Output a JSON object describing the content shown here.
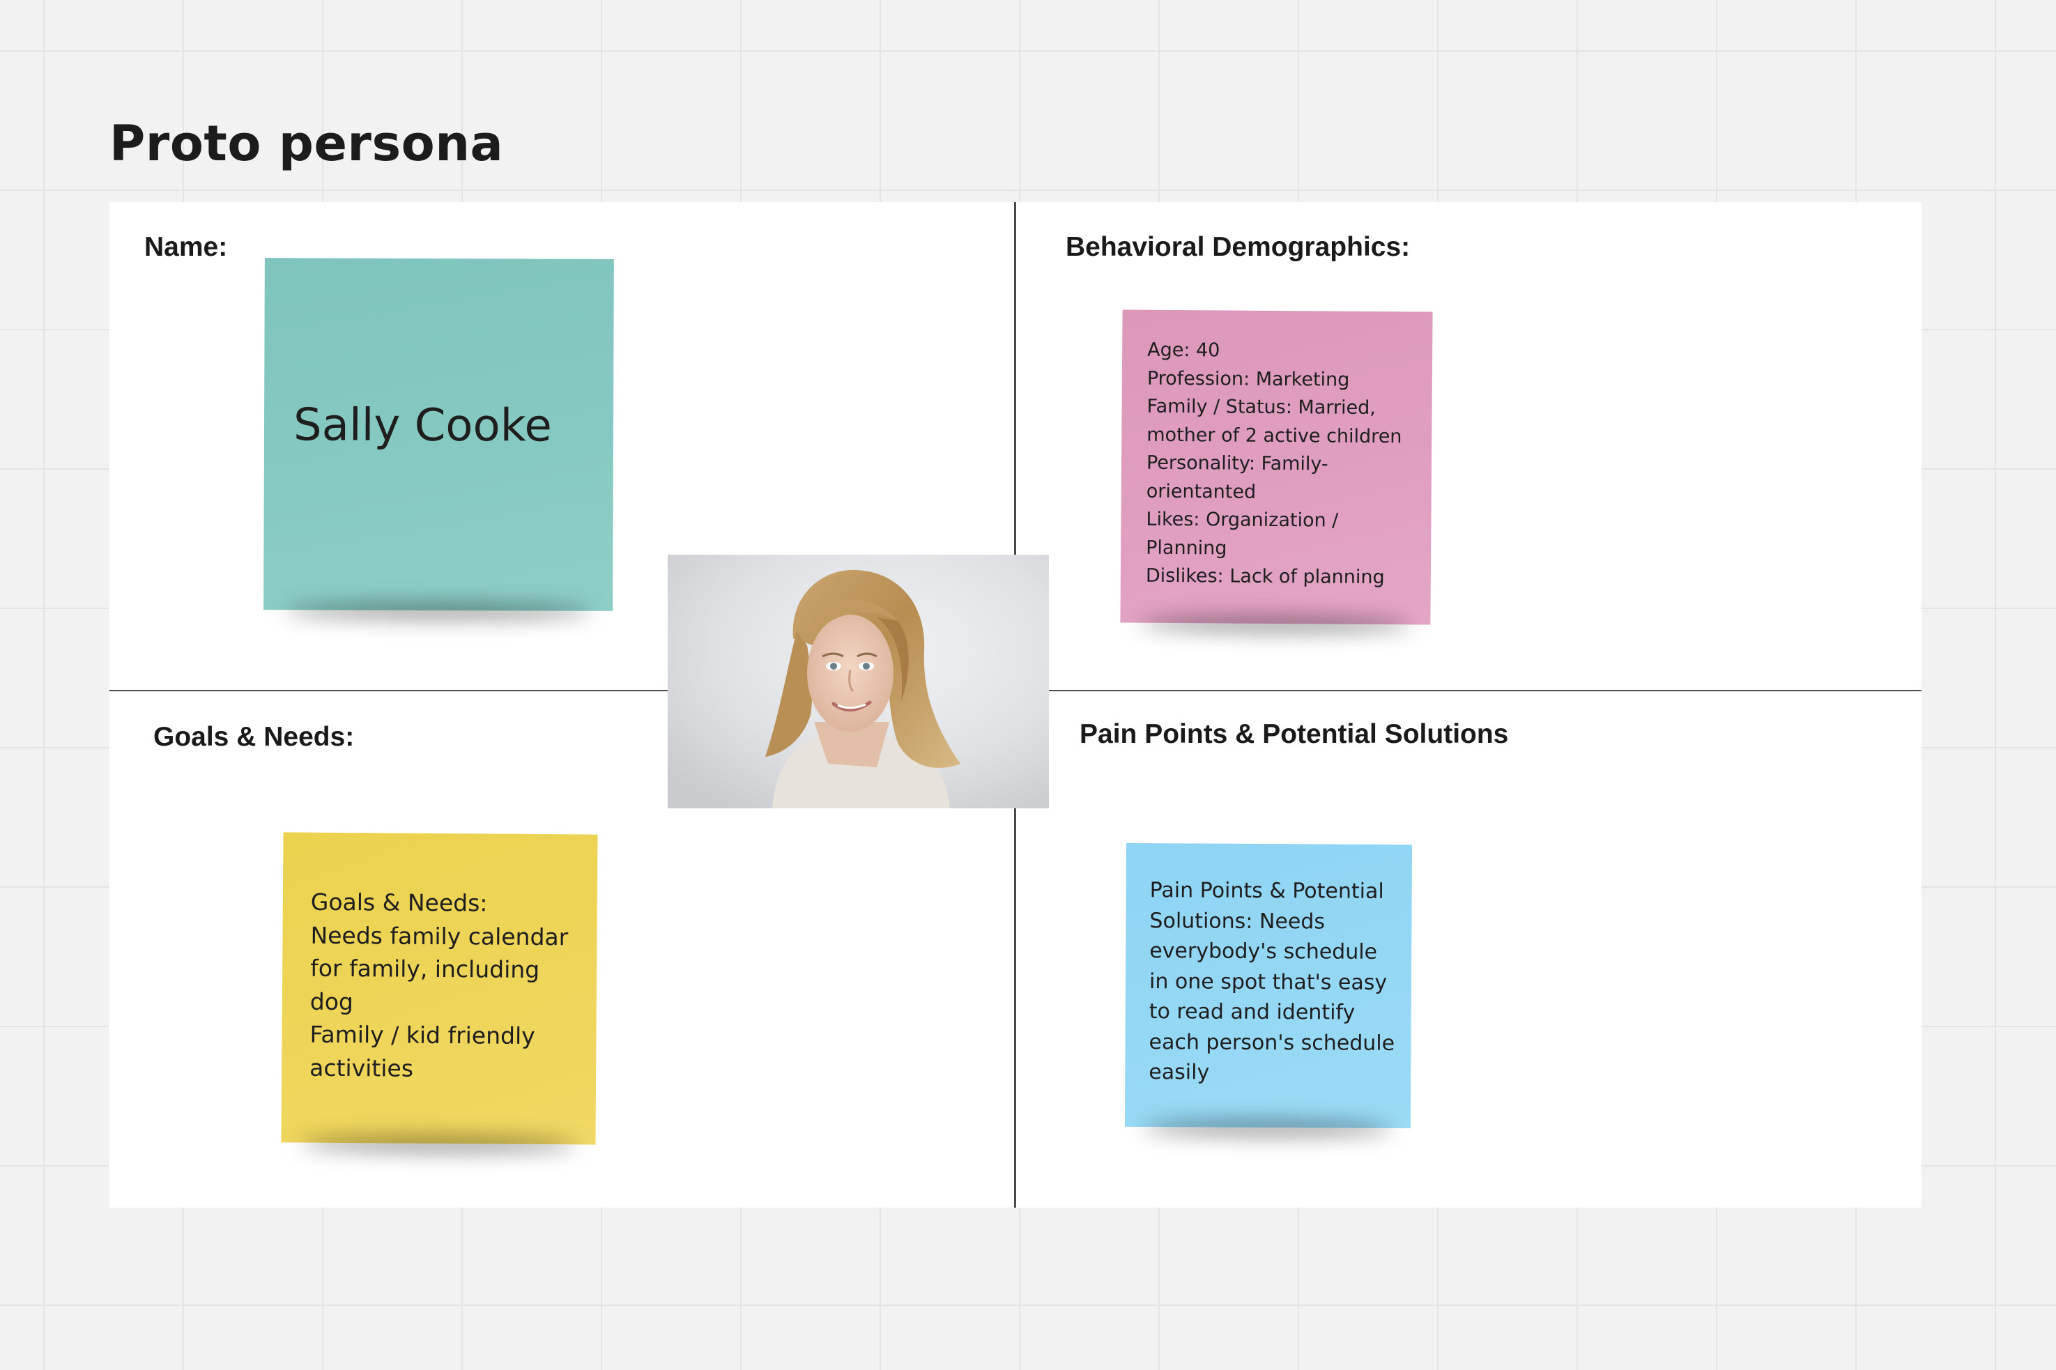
{
  "page": {
    "title": "Proto persona"
  },
  "board": {
    "quadrants": {
      "name": {
        "label": "Name:",
        "sticky_text": "Sally Cooke",
        "sticky_color": "#85c8c1"
      },
      "behavioral": {
        "label": "Behavioral Demographics:",
        "sticky_text": "Age: 40\nProfession: Marketing\nFamily / Status: Married,\nmother of 2 active children\nPersonality: Family-\norientanted\nLikes: Organization /\nPlanning\nDislikes: Lack of planning",
        "sticky_color": "#e09ebf"
      },
      "goals": {
        "label": "Goals & Needs:",
        "sticky_text": "Goals & Needs:\nNeeds family calendar\nfor family, including\ndog\nFamily / kid friendly\nactivities",
        "sticky_color": "#eed45a"
      },
      "pain_points": {
        "label": "Pain Points & Potential Solutions",
        "sticky_text": "Pain Points & Potential\nSolutions: Needs\neverybody's schedule\nin one spot that's easy\nto read and identify\neach person's schedule\neasily",
        "sticky_color": "#94d7f5"
      }
    },
    "photo": {
      "subject": "woman-portrait"
    }
  },
  "colors": {
    "canvas_background": "#f2f2f2",
    "grid_line": "#e4e4e4",
    "board_background": "#ffffff",
    "divider": "#4a4a4a"
  }
}
